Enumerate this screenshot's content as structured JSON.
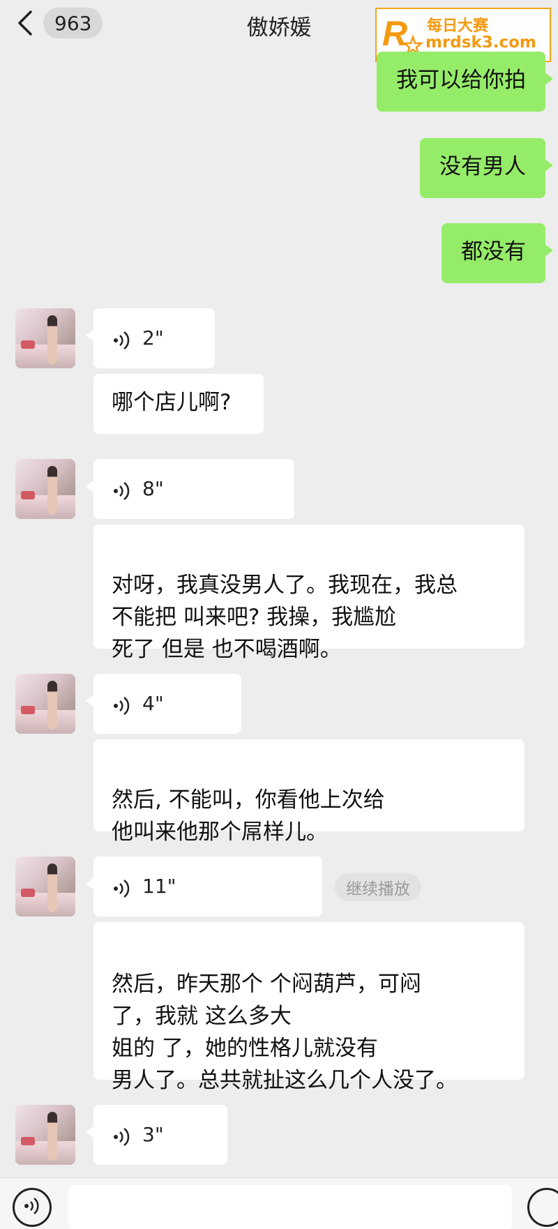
{
  "header": {
    "unread_count": "963",
    "title": "傲娇媛"
  },
  "watermark": {
    "logo_letter": "R",
    "line1": "每日大赛",
    "line2": "mrdsk3.com",
    "accent": "#f39a12"
  },
  "messages_out": [
    "我可以给你拍",
    "没有男人",
    "都没有"
  ],
  "voice_messages": [
    {
      "duration": "2\""
    },
    {
      "duration": "8\""
    },
    {
      "duration": "4\""
    },
    {
      "duration": "11\""
    },
    {
      "duration": "3\""
    }
  ],
  "messages_in": [
    "哪个店儿啊?",
    "对呀，我真没男人了。我现在，我总\n不能把     叫来吧? 我操，我尴尬\n死了     但是      也不喝酒啊。",
    "然后,       不能叫，你看他上次给\n他叫来他那个屌样儿。",
    "然后，昨天那个     个闷葫芦，可闷\n了，我就             这么多大\n姐的      了，她的性格儿就没有\n男人了。总共就扯这么几个人没了。"
  ],
  "replay_label": "继续播放",
  "colors": {
    "background": "#ededed",
    "outgoing_bubble": "#95ec69",
    "incoming_bubble": "#ffffff"
  }
}
